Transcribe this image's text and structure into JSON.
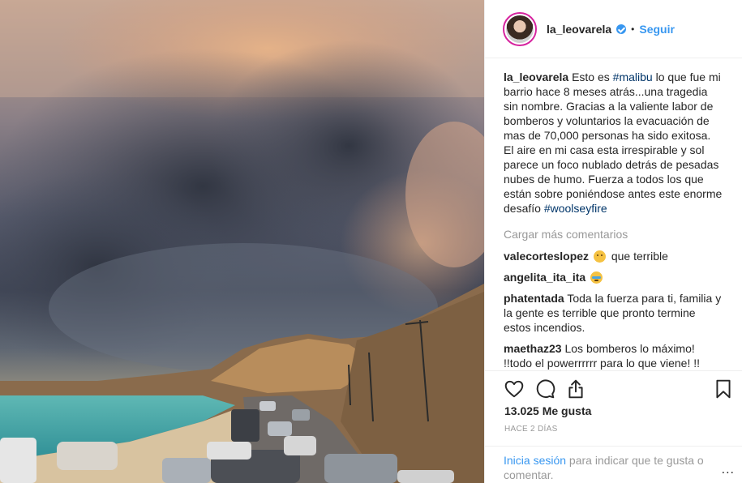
{
  "header": {
    "username": "la_leovarela",
    "separator": "•",
    "follow_label": "Seguir"
  },
  "caption": {
    "username": "la_leovarela",
    "text_1": "Esto es ",
    "hashtag_1": "#malibu",
    "text_2": " lo que fue mi barrio hace 8 meses atrás...una tragedia sin nombre. Gracias a la valiente labor de bomberos y voluntarios la evacuación de mas de 70,000 personas ha sido exitosa. El aire en mi casa esta irrespirable y sol parece un foco nublado detrás de pesadas nubes de humo. Fuerza a todos los que están sobre poniéndose antes este enorme desafío ",
    "hashtag_2": "#woolseyfire"
  },
  "load_more_label": "Cargar más comentarios",
  "comments": [
    {
      "username": "valecorteslopez",
      "emoji": "worried-face",
      "text": "que terrible"
    },
    {
      "username": "angelita_ita_ita",
      "emoji": "crying-face",
      "text": ""
    },
    {
      "username": "phatentada",
      "text": "Toda la fuerza para ti, familia y la gente es terrible que pronto termine estos incendios."
    },
    {
      "username": "maethaz23",
      "text": "Los bomberos lo máximo! !!todo el powerrrrrr para lo que viene! !!"
    }
  ],
  "actions": {
    "icons": [
      "heart-icon",
      "comment-icon",
      "share-icon",
      "bookmark-icon"
    ],
    "likes": "13.025 Me gusta",
    "time": "HACE 2 DÍAS"
  },
  "login": {
    "link": "Inicia sesión",
    "text": " para indicar que te gusta o comentar.",
    "more": "..."
  },
  "colors": {
    "link_blue": "#3897f0",
    "hashtag_blue": "#003569",
    "muted_gray": "#999999",
    "text": "#262626",
    "divider": "#efefef"
  }
}
